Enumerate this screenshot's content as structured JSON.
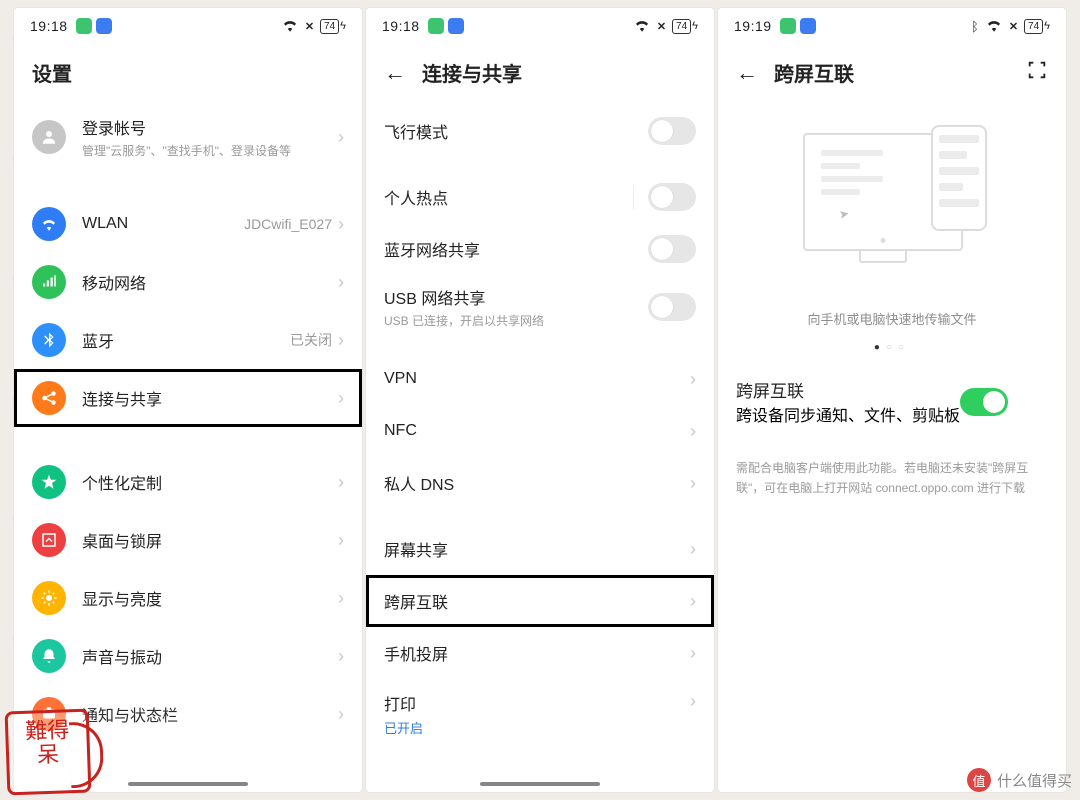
{
  "status": {
    "t1": "19:18",
    "t2": "19:18",
    "t3": "19:19",
    "battery": "74"
  },
  "screen1": {
    "title": "设置",
    "account": {
      "label": "登录帐号",
      "sub": "管理\"云服务\"、\"查找手机\"、登录设备等"
    },
    "items": [
      {
        "label": "WLAN",
        "value": "JDCwifi_E027",
        "icon": "wifi",
        "color": "c-blue"
      },
      {
        "label": "移动网络",
        "value": "",
        "icon": "signal",
        "color": "c-green"
      },
      {
        "label": "蓝牙",
        "value": "已关闭",
        "icon": "bt",
        "color": "c-blue2"
      },
      {
        "label": "连接与共享",
        "value": "",
        "icon": "share",
        "color": "c-orange",
        "highlight": true
      }
    ],
    "items2": [
      {
        "label": "个性化定制",
        "icon": "custom",
        "color": "c-teal"
      },
      {
        "label": "桌面与锁屏",
        "icon": "home",
        "color": "c-red"
      },
      {
        "label": "显示与亮度",
        "icon": "bright",
        "color": "c-yellow"
      },
      {
        "label": "声音与振动",
        "icon": "sound",
        "color": "c-mint"
      },
      {
        "label": "通知与状态栏",
        "icon": "notif",
        "color": "c-orange2"
      }
    ]
  },
  "screen2": {
    "title": "连接与共享",
    "toggles": [
      {
        "label": "飞行模式",
        "sub": ""
      },
      {
        "label": "个人热点",
        "sub": ""
      },
      {
        "label": "蓝牙网络共享",
        "sub": ""
      },
      {
        "label": "USB 网络共享",
        "sub": "USB 已连接，开启以共享网络"
      }
    ],
    "links": [
      {
        "label": "VPN"
      },
      {
        "label": "NFC"
      },
      {
        "label": "私人 DNS"
      }
    ],
    "links2": [
      {
        "label": "屏幕共享"
      },
      {
        "label": "跨屏互联",
        "highlight": true
      },
      {
        "label": "手机投屏"
      },
      {
        "label": "打印",
        "sub": "已开启",
        "subStyle": "blue"
      }
    ]
  },
  "screen3": {
    "title": "跨屏互联",
    "caption": "向手机或电脑快速地传输文件",
    "toggle": {
      "label": "跨屏互联",
      "sub": "跨设备同步通知、文件、剪贴板"
    },
    "note": "需配合电脑客户端使用此功能。若电脑还未安装\"跨屏互联\"，可在电脑上打开网站 connect.oppo.com 进行下载"
  },
  "watermark": {
    "stamp": "難得\n呆",
    "right": "什么值得买",
    "badge": "值"
  }
}
